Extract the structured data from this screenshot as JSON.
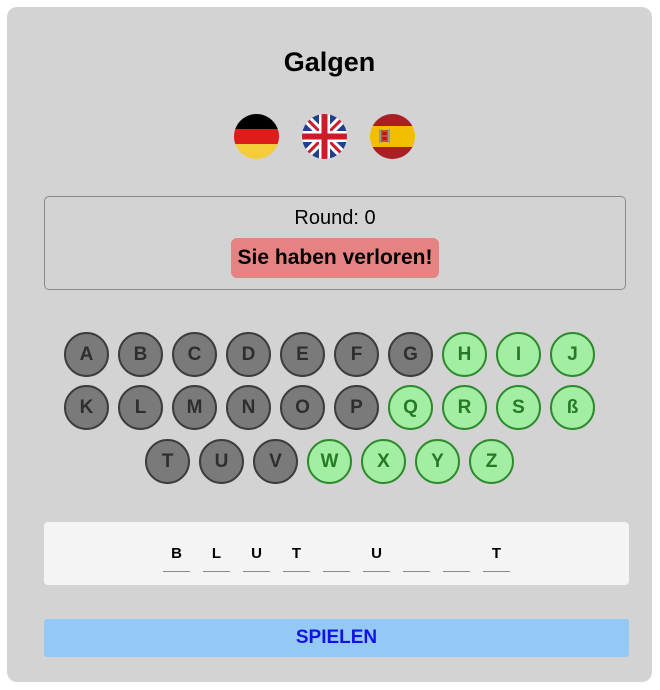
{
  "title": "Galgen",
  "languages": [
    {
      "code": "de",
      "icon": "germany-flag-icon"
    },
    {
      "code": "en",
      "icon": "uk-flag-icon"
    },
    {
      "code": "es",
      "icon": "spain-flag-icon"
    }
  ],
  "status": {
    "round_text": "Round: 0",
    "message": "Sie haben verloren!"
  },
  "keyboard": {
    "rows": [
      [
        {
          "l": "A",
          "s": "used"
        },
        {
          "l": "B",
          "s": "used"
        },
        {
          "l": "C",
          "s": "used"
        },
        {
          "l": "D",
          "s": "used"
        },
        {
          "l": "E",
          "s": "used"
        },
        {
          "l": "F",
          "s": "used"
        },
        {
          "l": "G",
          "s": "used"
        },
        {
          "l": "H",
          "s": "free"
        },
        {
          "l": "I",
          "s": "free"
        },
        {
          "l": "J",
          "s": "free"
        }
      ],
      [
        {
          "l": "K",
          "s": "used"
        },
        {
          "l": "L",
          "s": "used"
        },
        {
          "l": "M",
          "s": "used"
        },
        {
          "l": "N",
          "s": "used"
        },
        {
          "l": "O",
          "s": "used"
        },
        {
          "l": "P",
          "s": "used"
        },
        {
          "l": "Q",
          "s": "free"
        },
        {
          "l": "R",
          "s": "free"
        },
        {
          "l": "S",
          "s": "free"
        },
        {
          "l": "ß",
          "s": "free"
        }
      ],
      [
        {
          "l": "T",
          "s": "used"
        },
        {
          "l": "U",
          "s": "used"
        },
        {
          "l": "V",
          "s": "used"
        },
        {
          "l": "W",
          "s": "free"
        },
        {
          "l": "X",
          "s": "free"
        },
        {
          "l": "Y",
          "s": "free"
        },
        {
          "l": "Z",
          "s": "free"
        }
      ]
    ]
  },
  "word": [
    "B",
    "L",
    "U",
    "T",
    "",
    "U",
    "",
    "",
    "T"
  ],
  "play_button": "SPIELEN",
  "colors": {
    "used_key": "#7a7a7a",
    "free_key": "#a3eea3",
    "lost_badge": "#e58383",
    "play_button_bg": "#94c9f6",
    "play_button_text": "#1212e6"
  }
}
